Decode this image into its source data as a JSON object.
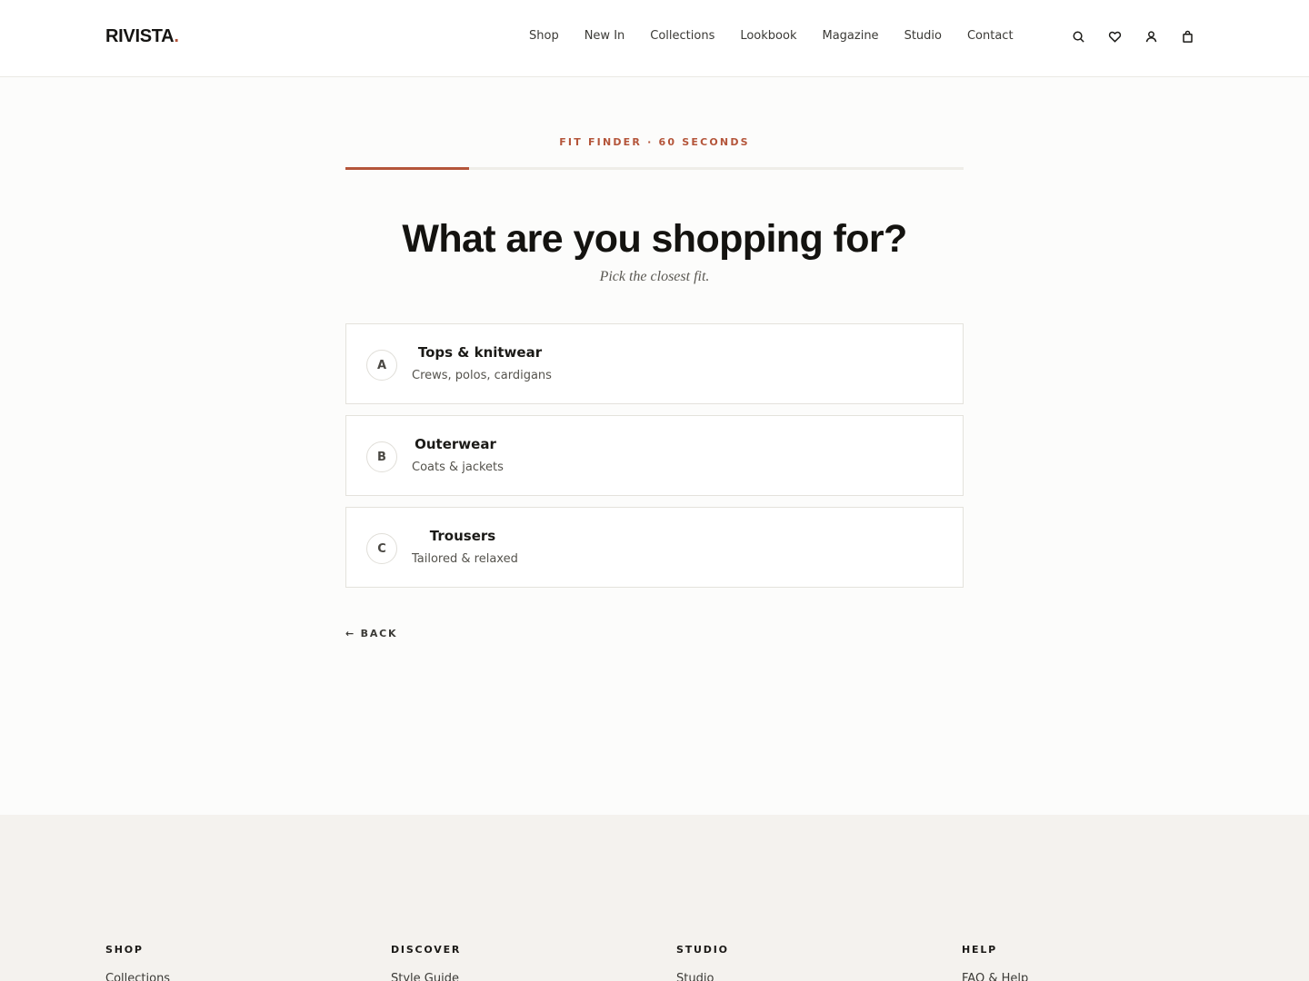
{
  "brand": {
    "name": "RIVISTA",
    "dot": ".",
    "accent": "#b4553a"
  },
  "nav": {
    "items": [
      "Shop",
      "New In",
      "Collections",
      "Lookbook",
      "Magazine",
      "Studio",
      "Contact"
    ]
  },
  "header_icons": [
    "search-icon",
    "heart-icon",
    "user-icon",
    "bag-icon"
  ],
  "quiz": {
    "eyebrow": "FIT FINDER · 60 SECONDS",
    "progress": 0.2,
    "question": "What are you shopping for?",
    "hint": "Pick the closest fit.",
    "options": [
      {
        "letter": "A",
        "title": "Tops & knitwear",
        "subtitle": "Crews, polos, cardigans"
      },
      {
        "letter": "B",
        "title": "Outerwear",
        "subtitle": "Coats & jackets"
      },
      {
        "letter": "C",
        "title": "Trousers",
        "subtitle": "Tailored & relaxed"
      }
    ],
    "back_label": "← BACK"
  },
  "footer": {
    "columns": [
      {
        "heading": "SHOP",
        "first_link": "Collections"
      },
      {
        "heading": "DISCOVER",
        "first_link": "Style Guide"
      },
      {
        "heading": "STUDIO",
        "first_link": "Studio"
      },
      {
        "heading": "HELP",
        "first_link": "FAQ & Help"
      }
    ]
  }
}
